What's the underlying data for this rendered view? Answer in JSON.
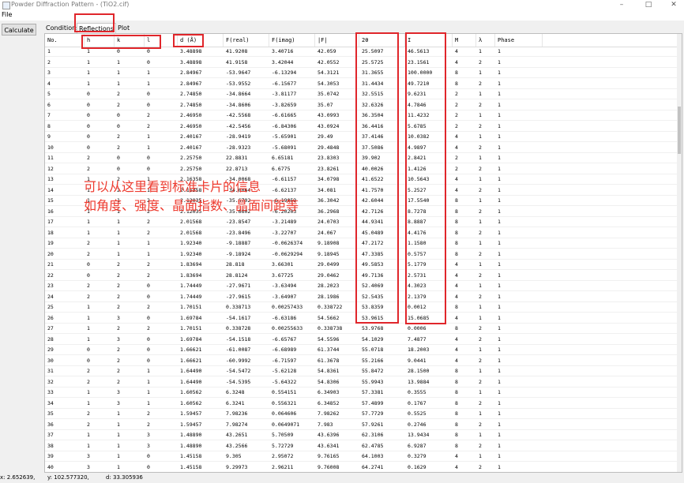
{
  "window": {
    "title": "Powder Diffraction Pattern - (TiO2.cif)"
  },
  "menu": {
    "file": "File"
  },
  "toolbar": {
    "calculate": "Calculate"
  },
  "tabs": {
    "conditions": "Conditions",
    "reflections": "Reflections",
    "plot": "Plot"
  },
  "columns": [
    "No.",
    "h",
    "k",
    "l",
    "d (Å)",
    "F(real)",
    "F(imag)",
    "|F|",
    "2θ",
    "I",
    "M",
    "λ",
    "Phase"
  ],
  "rows": [
    [
      "1",
      "1",
      "0",
      "0",
      "3.48898",
      "41.9208",
      "3.40716",
      "42.059",
      "25.5097",
      "46.5613",
      "4",
      "1",
      "1"
    ],
    [
      "2",
      "1",
      "1",
      "0",
      "3.48898",
      "41.9158",
      "3.42044",
      "42.0552",
      "25.5725",
      "23.1561",
      "4",
      "2",
      "1"
    ],
    [
      "3",
      "1",
      "1",
      "1",
      "2.84967",
      "-53.9647",
      "-6.13294",
      "54.3121",
      "31.3655",
      "100.0000",
      "8",
      "1",
      "1"
    ],
    [
      "4",
      "1",
      "1",
      "1",
      "2.84967",
      "-53.9552",
      "-6.15677",
      "54.3053",
      "31.4434",
      "49.7210",
      "8",
      "2",
      "1"
    ],
    [
      "5",
      "0",
      "2",
      "0",
      "2.74850",
      "-34.8664",
      "-3.81177",
      "35.0742",
      "32.5515",
      "9.6231",
      "2",
      "1",
      "1"
    ],
    [
      "6",
      "0",
      "2",
      "0",
      "2.74850",
      "-34.8606",
      "-3.82659",
      "35.07",
      "32.6326",
      "4.7846",
      "2",
      "2",
      "1"
    ],
    [
      "7",
      "0",
      "0",
      "2",
      "2.46950",
      "-42.5568",
      "-6.61665",
      "43.0993",
      "36.3504",
      "11.4232",
      "2",
      "1",
      "1"
    ],
    [
      "8",
      "0",
      "0",
      "2",
      "2.46950",
      "-42.5456",
      "-6.84306",
      "43.0924",
      "36.4416",
      "5.6785",
      "2",
      "2",
      "1"
    ],
    [
      "9",
      "0",
      "2",
      "1",
      "2.40167",
      "-28.9419",
      "-5.65901",
      "29.49",
      "37.4146",
      "10.0382",
      "4",
      "1",
      "1"
    ],
    [
      "10",
      "0",
      "2",
      "1",
      "2.40167",
      "-28.9323",
      "-5.68091",
      "29.4848",
      "37.5086",
      "4.9897",
      "4",
      "2",
      "1"
    ],
    [
      "11",
      "2",
      "0",
      "0",
      "2.25750",
      "22.8831",
      "6.65181",
      "23.8303",
      "39.902",
      "2.8421",
      "2",
      "1",
      "1"
    ],
    [
      "12",
      "2",
      "0",
      "0",
      "2.25750",
      "22.8713",
      "6.6775",
      "23.8261",
      "40.0026",
      "1.4126",
      "2",
      "2",
      "1"
    ],
    [
      "13",
      "1",
      "2",
      "1",
      "2.16358",
      "-34.0068",
      "-6.61157",
      "34.0798",
      "41.6522",
      "10.5643",
      "4",
      "1",
      "1"
    ],
    [
      "14",
      "1",
      "2",
      "1",
      "2.16358",
      "-34.0064",
      "-6.62137",
      "34.081",
      "41.7570",
      "5.2527",
      "4",
      "2",
      "1"
    ],
    [
      "15",
      "1",
      "1",
      "2",
      "2.12035",
      "-35.6702",
      "-6.19053",
      "36.3042",
      "42.6044",
      "17.5540",
      "8",
      "1",
      "1"
    ],
    [
      "16",
      "1",
      "1",
      "2",
      "2.12035",
      "-35.6602",
      "-6.20203",
      "36.2968",
      "42.7126",
      "8.7278",
      "8",
      "2",
      "1"
    ],
    [
      "17",
      "1",
      "1",
      "2",
      "2.01568",
      "-23.8547",
      "-3.21489",
      "24.0703",
      "44.9341",
      "8.8887",
      "8",
      "1",
      "1"
    ],
    [
      "18",
      "1",
      "1",
      "2",
      "2.01568",
      "-23.8496",
      "-3.22707",
      "24.067",
      "45.0489",
      "4.4176",
      "8",
      "2",
      "1"
    ],
    [
      "19",
      "2",
      "1",
      "1",
      "1.92340",
      "-9.18887",
      "-0.0626374",
      "9.18908",
      "47.2172",
      "1.1580",
      "8",
      "1",
      "1"
    ],
    [
      "20",
      "2",
      "1",
      "1",
      "1.92340",
      "-9.18924",
      "-0.0629294",
      "9.18945",
      "47.3385",
      "0.5757",
      "8",
      "2",
      "1"
    ],
    [
      "21",
      "0",
      "2",
      "2",
      "1.83694",
      "28.818",
      "3.66301",
      "29.0499",
      "49.5853",
      "5.1779",
      "4",
      "1",
      "1"
    ],
    [
      "22",
      "0",
      "2",
      "2",
      "1.83694",
      "28.8124",
      "3.67725",
      "29.0462",
      "49.7136",
      "2.5731",
      "4",
      "2",
      "1"
    ],
    [
      "23",
      "2",
      "2",
      "0",
      "1.74449",
      "-27.9671",
      "-3.63494",
      "28.2023",
      "52.4069",
      "4.3023",
      "4",
      "1",
      "1"
    ],
    [
      "24",
      "2",
      "2",
      "0",
      "1.74449",
      "-27.9615",
      "-3.64907",
      "28.1986",
      "52.5435",
      "2.1379",
      "4",
      "2",
      "1"
    ],
    [
      "25",
      "1",
      "2",
      "2",
      "1.70151",
      "0.338713",
      "0.00257433",
      "0.338722",
      "53.8359",
      "0.0012",
      "8",
      "1",
      "1"
    ],
    [
      "26",
      "1",
      "3",
      "0",
      "1.69784",
      "-54.1617",
      "-6.63186",
      "54.5662",
      "53.9615",
      "15.0685",
      "4",
      "1",
      "1"
    ],
    [
      "27",
      "1",
      "2",
      "2",
      "1.70151",
      "0.338728",
      "0.00255633",
      "0.338738",
      "53.9768",
      "0.0006",
      "8",
      "2",
      "1"
    ],
    [
      "28",
      "1",
      "3",
      "0",
      "1.69784",
      "-54.1518",
      "-6.65767",
      "54.5596",
      "54.1029",
      "7.4877",
      "4",
      "2",
      "1"
    ],
    [
      "29",
      "0",
      "2",
      "0",
      "1.66621",
      "-61.0087",
      "-6.68989",
      "61.3744",
      "55.0718",
      "18.2003",
      "4",
      "1",
      "1"
    ],
    [
      "30",
      "0",
      "2",
      "0",
      "1.66621",
      "-60.9992",
      "-6.71597",
      "61.3678",
      "55.2166",
      "9.0441",
      "4",
      "2",
      "1"
    ],
    [
      "31",
      "2",
      "2",
      "1",
      "1.64490",
      "-54.5472",
      "-5.62128",
      "54.8361",
      "55.8472",
      "28.1500",
      "8",
      "1",
      "1"
    ],
    [
      "32",
      "2",
      "2",
      "1",
      "1.64490",
      "-54.5395",
      "-5.64322",
      "54.8306",
      "55.9943",
      "13.9884",
      "8",
      "2",
      "1"
    ],
    [
      "33",
      "1",
      "3",
      "1",
      "1.60562",
      "6.3248",
      "0.554151",
      "6.34903",
      "57.3381",
      "0.3555",
      "8",
      "1",
      "1"
    ],
    [
      "34",
      "1",
      "3",
      "1",
      "1.60562",
      "6.3241",
      "0.556321",
      "6.34852",
      "57.4899",
      "0.1767",
      "8",
      "2",
      "1"
    ],
    [
      "35",
      "2",
      "1",
      "2",
      "1.59457",
      "7.98236",
      "0.064606",
      "7.98262",
      "57.7729",
      "0.5525",
      "8",
      "1",
      "1"
    ],
    [
      "36",
      "2",
      "1",
      "2",
      "1.59457",
      "7.98274",
      "0.0649071",
      "7.983",
      "57.9261",
      "0.2746",
      "8",
      "2",
      "1"
    ],
    [
      "37",
      "1",
      "1",
      "3",
      "1.48890",
      "43.2651",
      "5.70509",
      "43.6396",
      "62.3106",
      "13.9434",
      "8",
      "1",
      "1"
    ],
    [
      "38",
      "1",
      "1",
      "3",
      "1.48890",
      "43.2566",
      "5.72729",
      "43.6341",
      "62.4785",
      "6.9287",
      "8",
      "2",
      "1"
    ],
    [
      "39",
      "3",
      "1",
      "0",
      "1.45158",
      "9.305",
      "2.95072",
      "9.76165",
      "64.1003",
      "0.3279",
      "4",
      "1",
      "1"
    ],
    [
      "40",
      "3",
      "1",
      "0",
      "1.45158",
      "9.29973",
      "2.96211",
      "9.76008",
      "64.2741",
      "0.1629",
      "4",
      "2",
      "1"
    ]
  ],
  "annotation": {
    "line1": "可以从这里看到标准卡片的信息",
    "line2": "如角度、强度、晶面指数、晶面间距等"
  },
  "status": {
    "x": "x: 2.652639,",
    "y": "y: 102.577320,",
    "d": "d: 33.305936"
  },
  "colors": {
    "highlight": "#e0262b",
    "annotation": "#ee3b2f"
  }
}
